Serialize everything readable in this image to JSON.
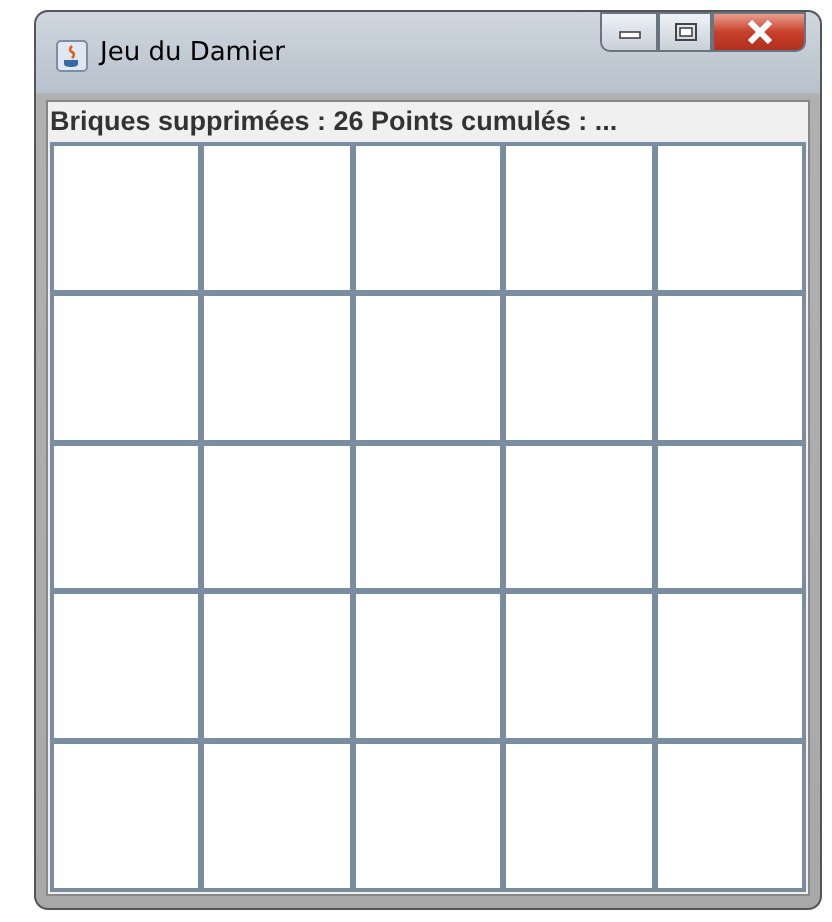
{
  "window": {
    "title": "Jeu du Damier",
    "controls": [
      {
        "kind": "minimize"
      },
      {
        "kind": "maximize"
      },
      {
        "kind": "close"
      }
    ]
  },
  "status": "Briques supprimées : 26 Points cumulés : ...",
  "board": {
    "rows": [
      {
        "cells": [
          {
            "kind": "empty"
          },
          {
            "kind": "empty"
          },
          {
            "kind": "empty"
          },
          {
            "kind": "empty"
          },
          {
            "kind": "empty"
          }
        ]
      },
      {
        "cells": [
          {
            "kind": "empty"
          },
          {
            "kind": "empty"
          },
          {
            "kind": "empty"
          },
          {
            "kind": "empty"
          },
          {
            "kind": "empty"
          }
        ]
      },
      {
        "cells": [
          {
            "kind": "empty"
          },
          {
            "kind": "empty"
          },
          {
            "kind": "empty"
          },
          {
            "kind": "empty"
          },
          {
            "kind": "empty"
          }
        ]
      },
      {
        "cells": [
          {
            "kind": "empty"
          },
          {
            "kind": "empty"
          },
          {
            "kind": "empty"
          },
          {
            "kind": "empty"
          },
          {
            "kind": "empty"
          }
        ]
      },
      {
        "cells": [
          {
            "kind": "empty"
          },
          {
            "kind": "empty"
          },
          {
            "kind": "empty"
          },
          {
            "kind": "empty"
          },
          {
            "kind": "empty"
          }
        ]
      }
    ]
  }
}
